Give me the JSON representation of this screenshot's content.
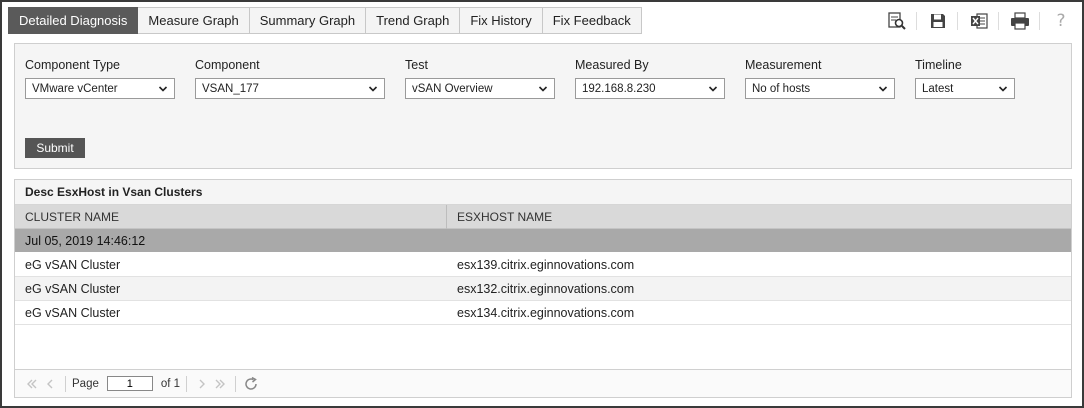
{
  "tabs": [
    {
      "label": "Detailed Diagnosis",
      "active": true
    },
    {
      "label": "Measure Graph"
    },
    {
      "label": "Summary Graph"
    },
    {
      "label": "Trend Graph"
    },
    {
      "label": "Fix History"
    },
    {
      "label": "Fix Feedback"
    }
  ],
  "toolbar": {
    "icons": [
      "search-report-icon",
      "save-icon",
      "excel-export-icon",
      "print-icon",
      "help-icon"
    ],
    "help_glyph": "?"
  },
  "filters": {
    "component_type": {
      "label": "Component Type",
      "value": "VMware vCenter"
    },
    "component": {
      "label": "Component",
      "value": "VSAN_177"
    },
    "test": {
      "label": "Test",
      "value": "vSAN Overview"
    },
    "measured_by": {
      "label": "Measured By",
      "value": "192.168.8.230"
    },
    "measurement": {
      "label": "Measurement",
      "value": "No of hosts"
    },
    "timeline": {
      "label": "Timeline",
      "value": "Latest"
    },
    "submit_label": "Submit"
  },
  "results": {
    "title": "Desc EsxHost in Vsan Clusters",
    "columns": [
      "CLUSTER NAME",
      "ESXHOST NAME"
    ],
    "group_timestamp": "Jul 05, 2019 14:46:12",
    "rows": [
      {
        "cluster": "eG vSAN Cluster",
        "host": "esx139.citrix.eginnovations.com"
      },
      {
        "cluster": "eG vSAN Cluster",
        "host": "esx132.citrix.eginnovations.com"
      },
      {
        "cluster": "eG vSAN Cluster",
        "host": "esx134.citrix.eginnovations.com"
      }
    ]
  },
  "pager": {
    "page_label": "Page",
    "page_value": "1",
    "of_label": "of 1"
  },
  "colors": {
    "active_tab": "#5a5a5a",
    "group_row": "#a9a9a9",
    "header_row": "#d9d9d9",
    "button": "#555555"
  }
}
